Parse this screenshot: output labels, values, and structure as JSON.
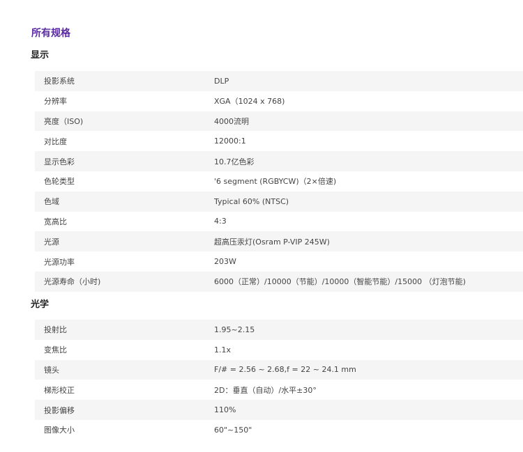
{
  "page_title": "所有规格",
  "sections": [
    {
      "title": "显示",
      "rows": [
        {
          "label": "投影系统",
          "value": "DLP"
        },
        {
          "label": "分辨率",
          "value": "XGA（1024 x 768)"
        },
        {
          "label": "亮度（ISO)",
          "value": "4000流明"
        },
        {
          "label": "对比度",
          "value": "12000:1"
        },
        {
          "label": "显示色彩",
          "value": "10.7亿色彩"
        },
        {
          "label": "色轮类型",
          "value": "'6 segment (RGBYCW)（2×倍速)"
        },
        {
          "label": "色域",
          "value": "Typical 60% (NTSC)"
        },
        {
          "label": "宽高比",
          "value": "4:3"
        },
        {
          "label": "光源",
          "value": "超高压汞灯(Osram P-VIP 245W)"
        },
        {
          "label": "光源功率",
          "value": "203W"
        },
        {
          "label": "光源寿命（小时)",
          "value": "6000（正常）/10000（节能）/10000（智能节能）/15000 （灯泡节能)"
        }
      ]
    },
    {
      "title": "光学",
      "rows": [
        {
          "label": "投射比",
          "value": "1.95~2.15"
        },
        {
          "label": "变焦比",
          "value": "1.1x"
        },
        {
          "label": "镜头",
          "value": "F/# = 2.56 ~ 2.68,f = 22 ~ 24.1 mm"
        },
        {
          "label": "梯形校正",
          "value": "2D：垂直（自动）/水平±30°"
        },
        {
          "label": "投影偏移",
          "value": "110%"
        },
        {
          "label": "图像大小",
          "value": "60\"~150\""
        }
      ]
    }
  ]
}
